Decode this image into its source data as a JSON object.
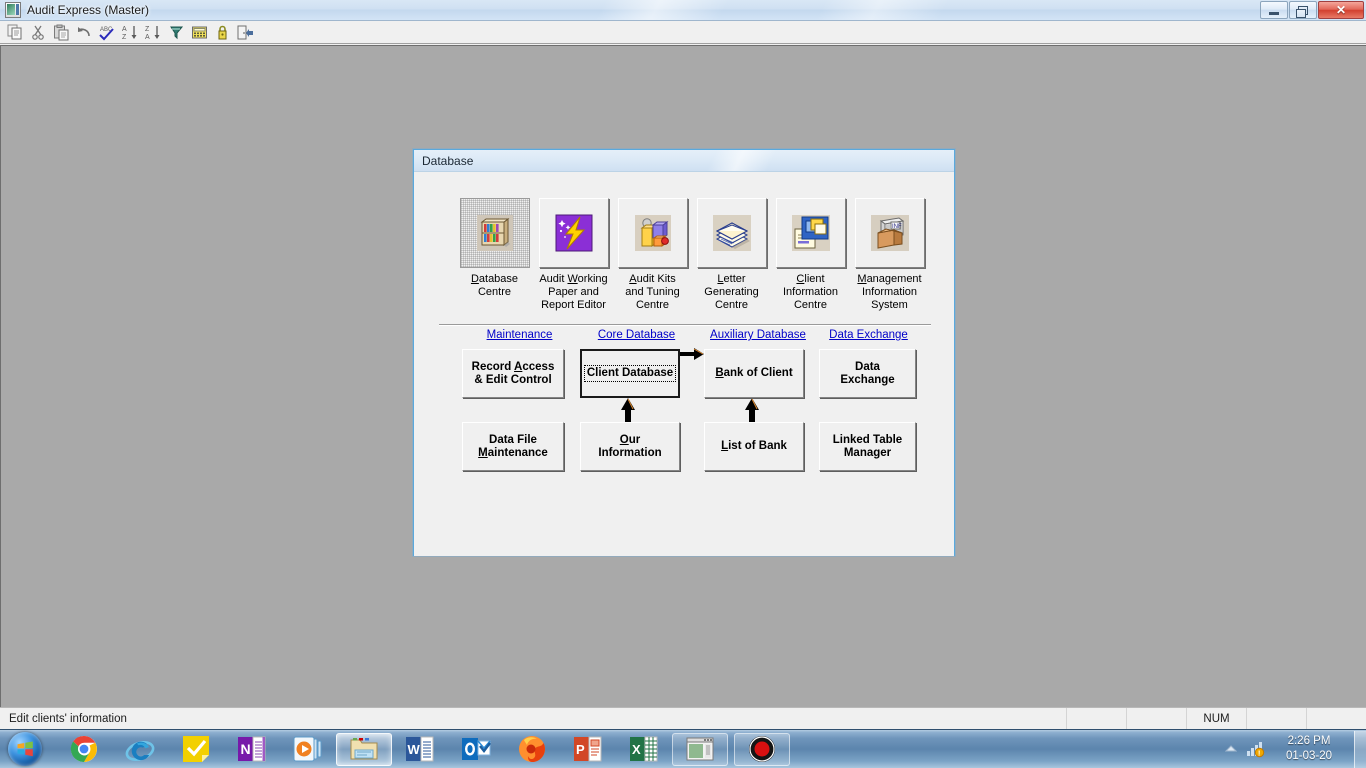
{
  "window": {
    "title": "Audit Express (Master)",
    "icon": "app-icon",
    "caption": {
      "minimize": "minimize",
      "restore": "restore",
      "close": "✕"
    }
  },
  "toolbar": {
    "buttons": [
      {
        "name": "copy-icon",
        "label": "Copy"
      },
      {
        "name": "cut-icon",
        "label": "Cut"
      },
      {
        "name": "paste-icon",
        "label": "Paste"
      },
      {
        "name": "undo-icon",
        "label": "Undo"
      },
      {
        "name": "spelling-icon",
        "label": "Spelling"
      },
      {
        "name": "sort-ascending-icon",
        "label": "Sort Ascending"
      },
      {
        "name": "sort-descending-icon",
        "label": "Sort Descending"
      },
      {
        "name": "filter-icon",
        "label": "Filter"
      },
      {
        "name": "calculator-icon",
        "label": "Calculator"
      },
      {
        "name": "lock-icon",
        "label": "Lock"
      },
      {
        "name": "exit-icon",
        "label": "Exit"
      }
    ]
  },
  "dialog": {
    "title": "Database",
    "icon_buttons": [
      {
        "name": "database-centre",
        "caption": "Database\nCentre",
        "accel": "D",
        "icon": "bookshelf-icon",
        "focused": true
      },
      {
        "name": "audit-working-paper-and-report-editor",
        "caption": "Audit Working\nPaper and\nReport Editor",
        "accel": "W",
        "icon": "lightning-wand-icon",
        "focused": false
      },
      {
        "name": "audit-kits-and-tuning-centre",
        "caption": "Audit Kits\nand Tuning\nCentre",
        "accel": "A",
        "icon": "blocks-icon",
        "focused": false
      },
      {
        "name": "letter-generating-centre",
        "caption": "Letter\nGenerating\nCentre",
        "accel": "L",
        "icon": "envelopes-icon",
        "focused": false
      },
      {
        "name": "client-information-centre",
        "caption": "Client\nInformation\nCentre",
        "accel": "C",
        "icon": "documents-icon",
        "focused": false
      },
      {
        "name": "management-information-system",
        "caption": "Management\nInformation\nSystem",
        "accel": "M",
        "icon": "archive-box-icon",
        "focused": false
      }
    ],
    "category_links": [
      {
        "name": "maintenance",
        "label": "Maintenance"
      },
      {
        "name": "core-database",
        "label": "Core Database"
      },
      {
        "name": "auxiliary-database",
        "label": "Auxiliary Database"
      },
      {
        "name": "data-exchange",
        "label": "Data Exchange"
      }
    ],
    "buttons": [
      {
        "name": "record-access-and-edit-control",
        "line1": "Record Access",
        "line2": "& Edit Control",
        "default": false,
        "focused": false
      },
      {
        "name": "client-database",
        "line1": "Client Database",
        "line2": "",
        "default": true,
        "focused": true
      },
      {
        "name": "bank-of-client",
        "line1": "Bank of Client",
        "line2": "",
        "default": false,
        "focused": false
      },
      {
        "name": "data-exchange-button",
        "line1": "Data",
        "line2": "Exchange",
        "default": false,
        "focused": false
      },
      {
        "name": "data-file-maintenance",
        "line1": "Data File",
        "line2": "Maintenance",
        "default": false,
        "focused": false
      },
      {
        "name": "our-information",
        "line1": "Our",
        "line2": "Information",
        "default": false,
        "focused": false
      },
      {
        "name": "list-of-bank",
        "line1": "List of Bank",
        "line2": "",
        "default": false,
        "focused": false
      },
      {
        "name": "linked-table-manager",
        "line1": "Linked Table",
        "line2": "Manager",
        "default": false,
        "focused": false
      }
    ],
    "colors": {
      "link": "#0000c8",
      "face": "#f0f0f0",
      "frame": "#5aa9dd"
    }
  },
  "statusbar": {
    "message": "Edit clients' information",
    "panels": [
      "",
      "",
      "NUM",
      "",
      ""
    ]
  },
  "taskbar": {
    "start": "start-orb",
    "items": [
      {
        "name": "taskbar-chrome",
        "icon": "chrome-icon"
      },
      {
        "name": "taskbar-internet-explorer",
        "icon": "internet-explorer-icon"
      },
      {
        "name": "taskbar-sticky-notes",
        "icon": "yellow-check-icon"
      },
      {
        "name": "taskbar-onenote",
        "icon": "onenote-icon"
      },
      {
        "name": "taskbar-media-player",
        "icon": "media-player-icon"
      },
      {
        "name": "taskbar-file-explorer",
        "icon": "file-explorer-icon"
      },
      {
        "name": "taskbar-word",
        "icon": "word-icon"
      },
      {
        "name": "taskbar-outlook",
        "icon": "outlook-icon"
      },
      {
        "name": "taskbar-firefox",
        "icon": "firefox-icon"
      },
      {
        "name": "taskbar-powerpoint",
        "icon": "powerpoint-icon"
      },
      {
        "name": "taskbar-excel",
        "icon": "excel-icon"
      },
      {
        "name": "taskbar-audit-express",
        "icon": "window-icon"
      },
      {
        "name": "taskbar-screen-recorder",
        "icon": "record-icon"
      }
    ],
    "tray": {
      "show_hidden": "chevron-up-icon",
      "network": "network-icon"
    },
    "clock": {
      "time": "2:26 PM",
      "date": "01-03-20"
    }
  }
}
